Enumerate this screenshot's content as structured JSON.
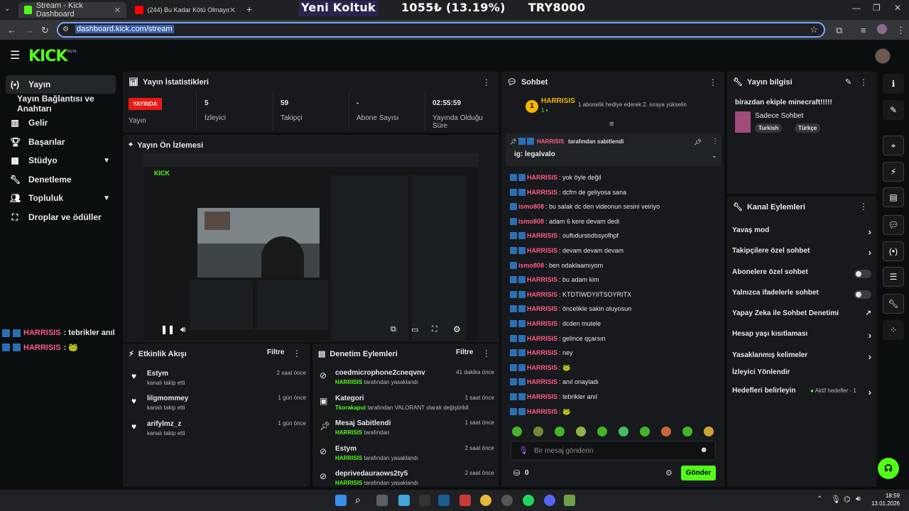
{
  "browser": {
    "tabs": [
      {
        "label": "Stream - Kick Dashboard",
        "active": true
      },
      {
        "label": "(244) Bu Kadar Kötü Olmayın !",
        "active": false
      }
    ],
    "url": "dashboard.kick.com/stream",
    "overlay": [
      "Yeni Koltuk",
      "1055₺ (13.19%)",
      "TRY8000"
    ]
  },
  "header": {
    "logo": "KICK",
    "beta": "BETA"
  },
  "sidebar": {
    "items": [
      {
        "label": "Yayın",
        "icon": "broadcast-icon",
        "active": true
      },
      {
        "label": "Yayın Bağlantısı ve Anahtarı",
        "icon": "",
        "active": false
      },
      {
        "label": "Gelir",
        "icon": "chart-icon"
      },
      {
        "label": "Başarılar",
        "icon": "trophy-icon"
      },
      {
        "label": "Stüdyo",
        "icon": "studio-icon",
        "expandable": true
      },
      {
        "label": "Denetleme",
        "icon": "wrench-icon"
      },
      {
        "label": "Topluluk",
        "icon": "people-icon",
        "expandable": true
      },
      {
        "label": "Droplar ve ödüller",
        "icon": "gift-icon"
      }
    ]
  },
  "stats": {
    "title": "Yayın İstatistikleri",
    "status_badge": "YAYINDA",
    "status_label": "Yayın",
    "items": [
      {
        "value": "5",
        "label": "İzleyici"
      },
      {
        "value": "59",
        "label": "Takipçi"
      },
      {
        "value": "-",
        "label": "Abone Sayısı"
      },
      {
        "value": "02:55:59",
        "label": "Yayında Olduğu Süre"
      }
    ]
  },
  "preview": {
    "title": "Yayın Ön İzlemesi"
  },
  "overlay_chat": [
    {
      "user": "HARRISIS",
      "msg": ": tebrikler anıl"
    },
    {
      "user": "HARRISIS",
      "msg": ": 🐸"
    }
  ],
  "activity": {
    "title": "Etkinlik Akışı",
    "filter": "Filtre",
    "items": [
      {
        "name": "Estym",
        "sub": "kanalı takip etti",
        "time": "2 saat önce"
      },
      {
        "name": "lilgmommey",
        "sub": "kanalı takip etti",
        "time": "1 gün önce"
      },
      {
        "name": "arifylmz_z",
        "sub": "kanalı takip etti",
        "time": "1 gün önce"
      }
    ]
  },
  "moderation": {
    "title": "Denetim Eylemleri",
    "filter": "Filtre",
    "items": [
      {
        "name": "coedmicrophone2cneqvnv",
        "sub_user": "HARRISIS",
        "sub": "tarafından yasaklandı",
        "time": "41 dakika önce"
      },
      {
        "name": "Kategori",
        "sub_user": "Tkorakaput",
        "sub": "tarafından VALORANT olarak değiştirildi",
        "time": "1 saat önce"
      },
      {
        "name": "Mesaj Sabitlendi",
        "sub_user": "HARRISIS",
        "sub": "tarafından",
        "time": "1 saat önce"
      },
      {
        "name": "Estym",
        "sub_user": "HARRISIS",
        "sub": "tarafından yasaklandı",
        "time": "2 saat önce"
      },
      {
        "name": "deprivedauraows2ty5",
        "sub_user": "HARRISIS",
        "sub": "tarafından yasaklandı",
        "time": "2 saat önce"
      }
    ]
  },
  "chat": {
    "title": "Sohbet",
    "top_user": "HARRISIS",
    "top_rank": "1",
    "gift_text": "1 abonelik hediye ederek 2. sıraya yükselin",
    "pinned_by_user": "HARRISIS",
    "pinned_by": "tarafından sabitlendi",
    "pinned_msg": "ig: legalvalo",
    "messages": [
      {
        "user": "HARRISIS",
        "msg": ": yok öyle değil",
        "color": "#ff5c87"
      },
      {
        "user": "HARRISIS",
        "msg": ": dcfrn de geliyosa sana",
        "color": "#ff5c87"
      },
      {
        "user": "ismo808",
        "msg": ": bu salak dc den videonun sesini veiriyo",
        "color": "#ff5c87"
      },
      {
        "user": "ismo808",
        "msg": ": adam 6 kere devam dedi",
        "color": "#ff5c87"
      },
      {
        "user": "HARRISIS",
        "msg": ": ouftıdurstıdtısyofhpf",
        "color": "#ff5c87"
      },
      {
        "user": "HARRISIS",
        "msg": ": devam devam devam",
        "color": "#ff5c87"
      },
      {
        "user": "ismo808",
        "msg": ": ben odaklaamıyom",
        "color": "#ff5c87"
      },
      {
        "user": "HARRISIS",
        "msg": ": bu adam kim",
        "color": "#ff5c87"
      },
      {
        "user": "HARRISIS",
        "msg": ": KTDTIWDYIITSOYRITX",
        "color": "#ff5c87"
      },
      {
        "user": "HARRISIS",
        "msg": ": öncelikle sakin oluyosun",
        "color": "#ff5c87"
      },
      {
        "user": "HARRISIS",
        "msg": ": dcden mutele",
        "color": "#ff5c87"
      },
      {
        "user": "HARRISIS",
        "msg": ": gelince qçarsın",
        "color": "#ff5c87"
      },
      {
        "user": "HARRISIS",
        "msg": ": ney",
        "color": "#ff5c87"
      },
      {
        "user": "HARRISIS",
        "msg": ": 🐸",
        "color": "#ff5c87"
      },
      {
        "user": "HARRISIS",
        "msg": ": anıl onayladı",
        "color": "#ff5c87"
      },
      {
        "user": "HARRISIS",
        "msg": ": tebrikler anıl",
        "color": "#ff5c87"
      },
      {
        "user": "HARRISIS",
        "msg": ": 🐸",
        "color": "#ff5c87"
      }
    ],
    "input_placeholder": "Bir mesaj gönderin",
    "points": "0",
    "send_label": "Gönder"
  },
  "stream_info": {
    "title": "Yayın bilgisi",
    "stream_title": "birazdan ekiple minecraft!!!!!",
    "category": "Sadece Sohbet",
    "tags": [
      "Turkish",
      "Türkçe"
    ]
  },
  "channel_actions": {
    "title": "Kanal Eylemleri",
    "items": [
      {
        "label": "Yavaş mod",
        "kind": "arrow"
      },
      {
        "label": "Takipçilere özel sohbet",
        "kind": "arrow"
      },
      {
        "label": "Abonelere özel sohbet",
        "kind": "toggle"
      },
      {
        "label": "Yalnızca ifadelerle sohbet",
        "kind": "toggle"
      },
      {
        "label": "Yapay Zeka ile Sohbet Denetimi",
        "kind": "external"
      },
      {
        "label": "Hesap yaşı kısıtlaması",
        "kind": "arrow"
      },
      {
        "label": "Yasaklanmış kelimeler",
        "kind": "arrow"
      },
      {
        "label": "İzleyici Yönlendir",
        "kind": "none"
      },
      {
        "label": "Hedefleri belirleyin",
        "kind": "goals"
      }
    ],
    "goals_status": "Aktif hedefler - 1"
  },
  "taskbar": {
    "time": "18:59",
    "date": "13.01.2026"
  },
  "colors": {
    "kick_green": "#53fc18",
    "live_red": "#e91916",
    "username_pink": "#ff5c87"
  }
}
